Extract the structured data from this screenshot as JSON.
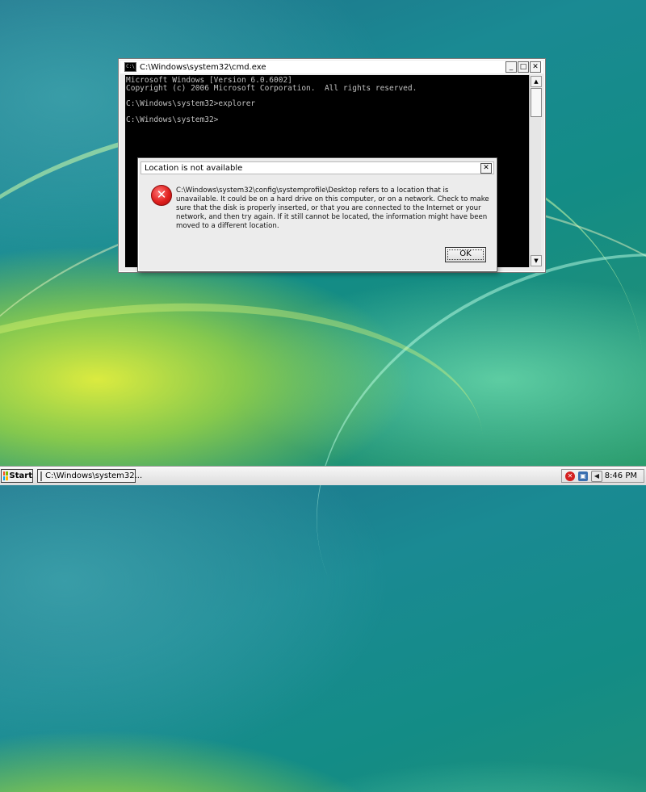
{
  "cmd_window": {
    "title": "C:\\Windows\\system32\\cmd.exe",
    "console_text": "Microsoft Windows [Version 6.0.6002]\nCopyright (c) 2006 Microsoft Corporation.  All rights reserved.\n\nC:\\Windows\\system32>explorer\n\nC:\\Windows\\system32>"
  },
  "dialog": {
    "title": "Location is not available",
    "message": "C:\\Windows\\system32\\config\\systemprofile\\Desktop refers to a location that is unavailable. It could be on a hard drive on this computer, or on a network. Check to make sure that the disk is properly inserted, or that you are connected to the Internet or your network, and then try again. If it still cannot be located, the information might have been moved to a different location.",
    "ok_label": "OK",
    "icon": "error-icon"
  },
  "taskbar": {
    "start_label": "Start",
    "items": [
      {
        "label": "C:\\Windows\\system32..."
      }
    ],
    "clock": "8:46 PM"
  },
  "colors": {
    "error_red": "#e0201e",
    "console_bg": "#000000",
    "console_fg": "#c0c0c0"
  }
}
